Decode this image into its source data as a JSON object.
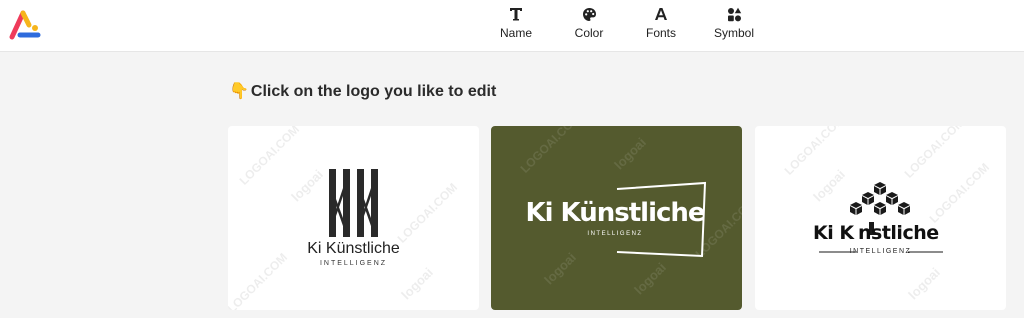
{
  "toolbar": {
    "items": [
      {
        "label": "Name",
        "icon": "text-icon"
      },
      {
        "label": "Color",
        "icon": "palette-icon"
      },
      {
        "label": "Fonts",
        "icon": "font-icon"
      },
      {
        "label": "Symbol",
        "icon": "shapes-icon"
      }
    ]
  },
  "heading": {
    "hand": "👇",
    "text": "Click on the logo you like to edit"
  },
  "cards": [
    {
      "name": "Ki Künstliche",
      "tagline": "INTELLIGENZ",
      "background": "#ffffff",
      "text_color": "#222222",
      "icon": "double-k-icon"
    },
    {
      "name": "Ki Künstliche",
      "tagline": "INTELLIGENZ",
      "background": "#545a2e",
      "text_color": "#ffffff",
      "icon": "frame-icon"
    },
    {
      "name_left": "Ki K",
      "name_right": "nstliche",
      "tagline": "INTELLIGENZ",
      "background": "#ffffff",
      "text_color": "#111111",
      "icon": "cube-stack-icon"
    }
  ],
  "watermark": {
    "brand": "logoai",
    "domain": "LOGOAI.COM"
  },
  "colors": {
    "accent_red": "#ef3b5a",
    "accent_blue": "#2e6bdc",
    "accent_yellow": "#f6b51c",
    "olive": "#545a2e"
  }
}
